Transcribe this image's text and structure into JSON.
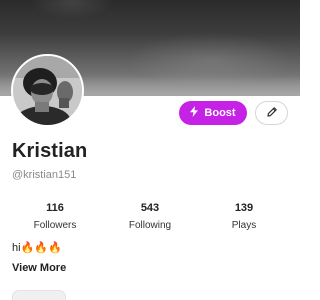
{
  "profile": {
    "name": "Kristian",
    "handle": "@kristian151",
    "bio": "hi🔥🔥🔥",
    "view_more": "View More"
  },
  "actions": {
    "boost_label": "Boost",
    "boost_icon": "lightning-bolt-icon",
    "edit_icon": "pencil-icon"
  },
  "stats": [
    {
      "value": "116",
      "label": "Followers"
    },
    {
      "value": "543",
      "label": "Following"
    },
    {
      "value": "139",
      "label": "Plays"
    }
  ],
  "colors": {
    "accent": "#c522e6",
    "text": "#222222",
    "muted": "#8a8a8a"
  }
}
